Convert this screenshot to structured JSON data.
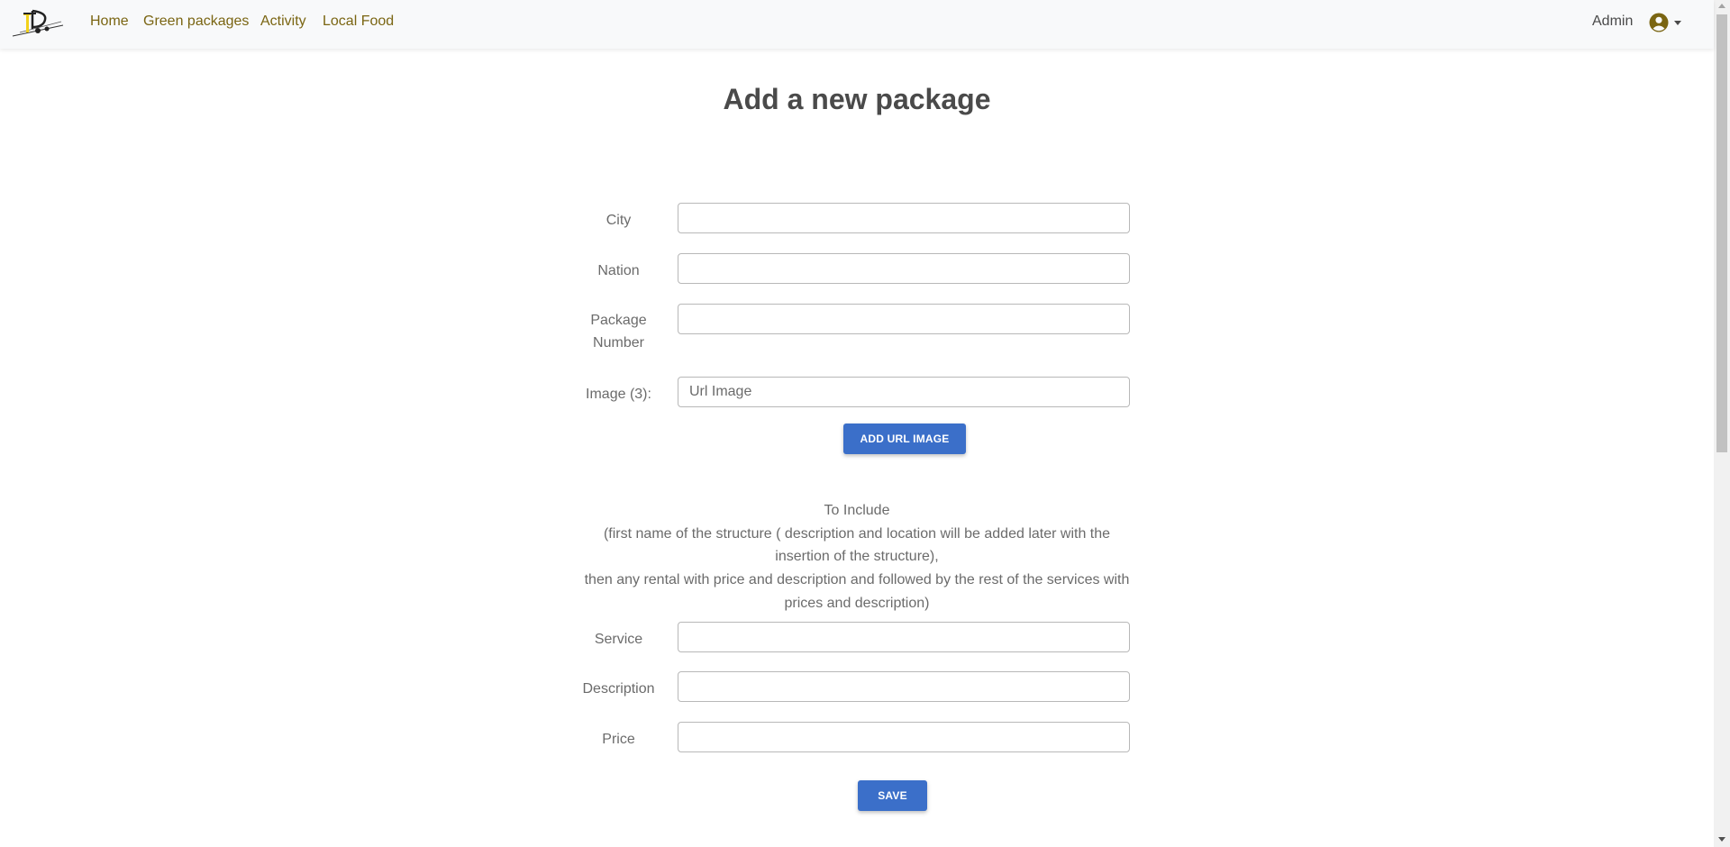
{
  "navbar": {
    "logo_icon": "travel-logo-icon",
    "links": [
      "Home",
      "Green packages",
      "Activity",
      "Local Food"
    ],
    "user_label": "Admin",
    "user_icon": "user-circle-icon",
    "dropdown_icon": "caret-down-icon"
  },
  "page": {
    "title": "Add a new package"
  },
  "form": {
    "city_label": "City",
    "nation_label": "Nation",
    "package_number_label": [
      "Package",
      "Number"
    ],
    "image_label": "Image (3):",
    "image_placeholder": "Url Image",
    "add_image_button": "ADD URL IMAGE",
    "include_text": [
      "To Include",
      "(first name of the structure ( description and location will be added later with the",
      "insertion of the structure),",
      "then any rental with price and description and followed by the rest of the services with",
      "prices and description)"
    ],
    "service_label": "Service",
    "description_label": "Description",
    "price_label": "Price",
    "save_button": "SAVE"
  },
  "colors": {
    "nav_link": "#7a6512",
    "button": "#3b6fc9",
    "navbar_bg": "#f8f9fa",
    "logo_yellow": "#f2d21a"
  }
}
